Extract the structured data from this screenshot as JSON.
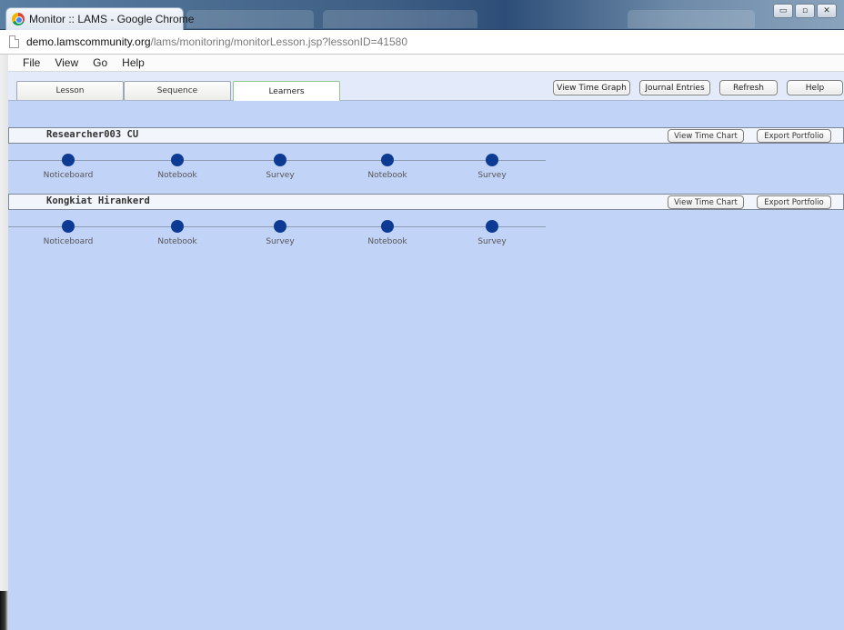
{
  "window": {
    "tab_title": "Monitor :: LAMS - Google Chrome",
    "controls": {
      "minimize": "▭",
      "maximize": "▫",
      "close": "✕"
    }
  },
  "address": {
    "domain": "demo.lamscommunity.org",
    "path": "/lams/monitoring/monitorLesson.jsp?lessonID=41580"
  },
  "menu": [
    "File",
    "View",
    "Go",
    "Help"
  ],
  "tabs": [
    {
      "label": "Lesson",
      "active": false
    },
    {
      "label": "Sequence",
      "active": false
    },
    {
      "label": "Learners",
      "active": true
    }
  ],
  "toolbar": {
    "view_time_graph": "View Time Graph",
    "journal_entries": "Journal Entries",
    "refresh": "Refresh",
    "help": "Help"
  },
  "learners": [
    {
      "name": "Researcher003 CU",
      "view_time_chart": "View Time Chart",
      "export_portfolio": "Export Portfolio",
      "activities": [
        "Noticeboard",
        "Notebook",
        "Survey",
        "Notebook",
        "Survey"
      ]
    },
    {
      "name": "Kongkiat Hirankerd",
      "view_time_chart": "View Time Chart",
      "export_portfolio": "Export Portfolio",
      "activities": [
        "Noticeboard",
        "Notebook",
        "Survey",
        "Notebook",
        "Survey"
      ]
    }
  ],
  "colors": {
    "background": "#c2d3f8",
    "activity_dot": "#0d3b94"
  }
}
